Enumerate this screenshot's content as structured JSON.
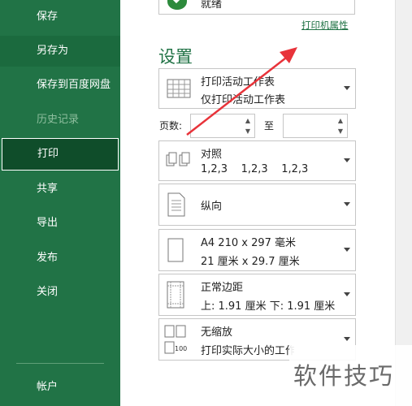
{
  "sidebar": {
    "items": [
      {
        "label": "保存"
      },
      {
        "label": "另存为"
      },
      {
        "label": "保存到百度网盘"
      },
      {
        "label": "历史记录"
      },
      {
        "label": "打印"
      },
      {
        "label": "共享"
      },
      {
        "label": "导出"
      },
      {
        "label": "发布"
      },
      {
        "label": "关闭"
      },
      {
        "label": "帐户"
      }
    ]
  },
  "printer": {
    "status": "就绪",
    "properties_link": "打印机属性"
  },
  "settings": {
    "heading": "设置",
    "what_to_print": {
      "line1": "打印活动工作表",
      "line2": "仅打印活动工作表"
    },
    "pages": {
      "label": "页数:",
      "to_label": "至",
      "from_value": "",
      "to_value": ""
    },
    "collation": {
      "line1": "对照",
      "line2": "1,2,3    1,2,3    1,2,3"
    },
    "orientation": {
      "line1": "纵向"
    },
    "paper": {
      "line1": "A4 210 x 297 毫米",
      "line2": "21 厘米 x 29.7 厘米"
    },
    "margins": {
      "line1": "正常边距",
      "line2": "上: 1.91 厘米 下: 1.91 厘米"
    },
    "scaling": {
      "line1": "无缩放",
      "line2": "打印实际大小的工作表",
      "icon_text": "100"
    }
  },
  "watermark": {
    "text": "软件技巧"
  },
  "colors": {
    "brand": "#217346",
    "active": "#0f4d2a",
    "arrow": "#e8333a"
  }
}
